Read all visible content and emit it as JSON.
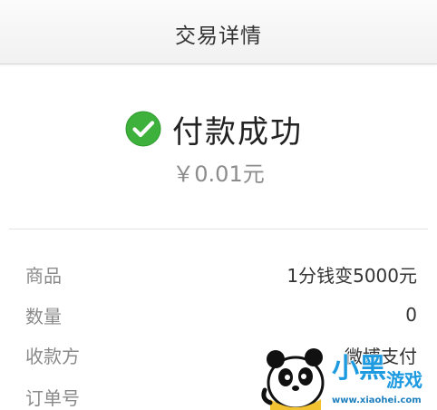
{
  "header": {
    "title": "交易详情"
  },
  "status": {
    "icon": "check-circle-icon",
    "icon_color": "#3db13c",
    "text": "付款成功",
    "amount": "￥0.01元"
  },
  "details": [
    {
      "label": "商品",
      "value": "1分钱变5000元"
    },
    {
      "label": "数量",
      "value": "0"
    },
    {
      "label": "收款方",
      "value": "微博支付"
    },
    {
      "label": "订单号",
      "value": ""
    }
  ],
  "watermark": {
    "logo": "panda-mascot-logo",
    "site_text": "小黑游戏",
    "url_text": "www.xiaohei.com"
  }
}
